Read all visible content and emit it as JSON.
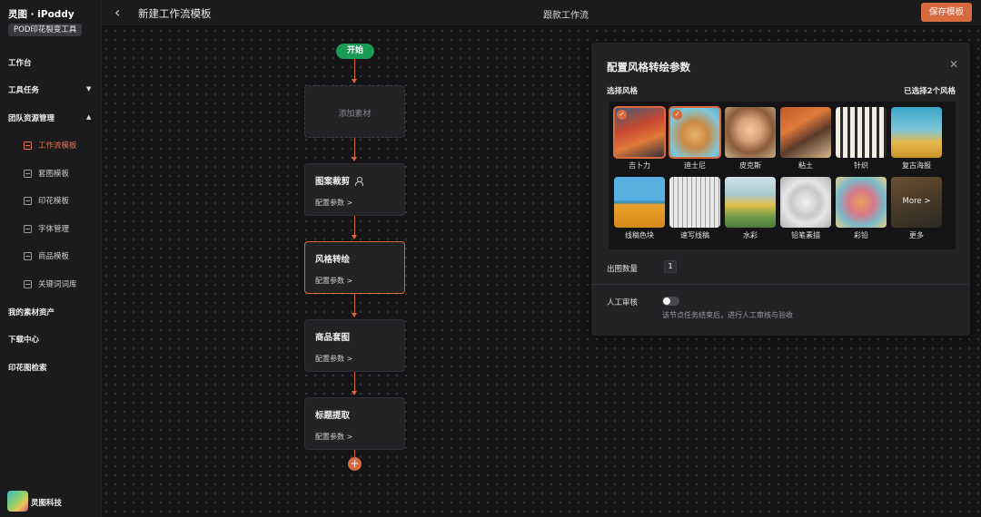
{
  "app": {
    "brand": "灵图 · iPoddy",
    "badge": "POD印花裂变工具"
  },
  "sidebar": {
    "nav": [
      {
        "label": "工作台"
      },
      {
        "label": "工具任务"
      },
      {
        "label": "团队资源管理"
      },
      {
        "label": "我的素材资产"
      },
      {
        "label": "下载中心"
      },
      {
        "label": "印花图检索"
      }
    ],
    "sub_items": [
      {
        "label": "工作流模板"
      },
      {
        "label": "套图模板"
      },
      {
        "label": "印花模板"
      },
      {
        "label": "字体管理"
      },
      {
        "label": "商品模板"
      },
      {
        "label": "关键词词库"
      }
    ],
    "footer_name": "灵图科技"
  },
  "header": {
    "back_icon": "chevron-left-icon",
    "title": "新建工作流模板",
    "center": "跟款工作流",
    "save_label": "保存模板"
  },
  "flow": {
    "start_label": "开始",
    "add_material": "添加素材",
    "nodes": [
      {
        "title": "图案裁剪",
        "config": "配置参数  >"
      },
      {
        "title": "风格转绘",
        "config": "配置参数  >"
      },
      {
        "title": "商品套图",
        "config": "配置参数  >"
      },
      {
        "title": "标题提取",
        "config": "配置参数  >"
      }
    ],
    "add_symbol": "+"
  },
  "panel": {
    "title": "配置风格转绘参数",
    "close": "✕",
    "style_label": "选择风格",
    "selected_count": "已选择2个风格",
    "styles": [
      {
        "label": "吉卜力",
        "selected": true
      },
      {
        "label": "迪士尼",
        "selected": true
      },
      {
        "label": "皮克斯",
        "selected": false
      },
      {
        "label": "粘土",
        "selected": false
      },
      {
        "label": "针织",
        "selected": false
      },
      {
        "label": "复古海报",
        "selected": false
      },
      {
        "label": "线稿色块",
        "selected": false
      },
      {
        "label": "速写线稿",
        "selected": false
      },
      {
        "label": "水彩",
        "selected": false
      },
      {
        "label": "铅笔素描",
        "selected": false
      },
      {
        "label": "彩铅",
        "selected": false
      },
      {
        "label": "更多",
        "selected": false
      }
    ],
    "more_tile_text": "More  >",
    "check_mark": "✓",
    "output_count_label": "出图数量",
    "output_count_value": "1",
    "review_label": "人工审核",
    "review_enabled": false,
    "review_desc": "该节点任务结束后，进行人工审核与验收"
  },
  "colors": {
    "accent": "#d86a40",
    "start_green": "#1c9a58",
    "panel_bg": "#232326"
  }
}
